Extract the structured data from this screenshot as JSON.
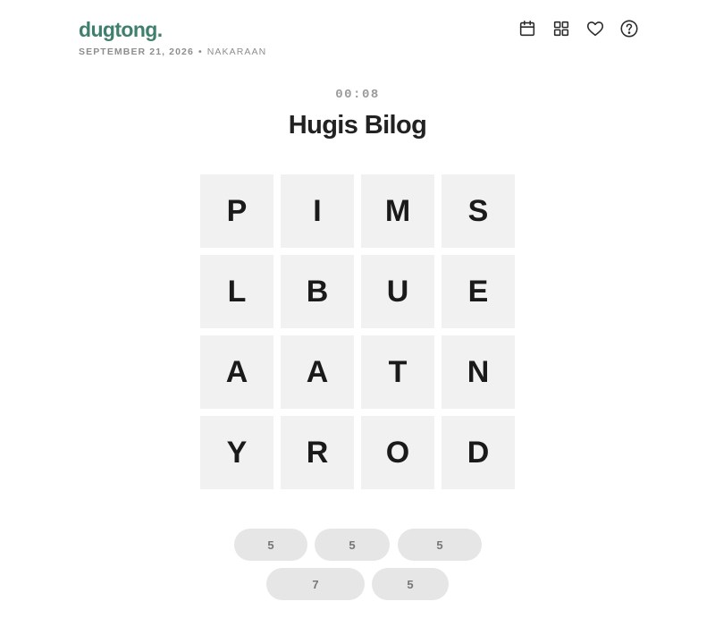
{
  "header": {
    "logo": "dugtong.",
    "date": "SEPTEMBER 21, 2026",
    "separator": "•",
    "status": "NAKARAAN",
    "icons": [
      "calendar-icon",
      "grid-icon",
      "heart-icon",
      "help-icon"
    ]
  },
  "game": {
    "timer": "00:08",
    "title": "Hugis Bilog",
    "grid": [
      [
        "P",
        "I",
        "M",
        "S"
      ],
      [
        "L",
        "B",
        "U",
        "E"
      ],
      [
        "A",
        "A",
        "T",
        "N"
      ],
      [
        "Y",
        "R",
        "O",
        "D"
      ]
    ],
    "word_lengths": [
      "5",
      "5",
      "5",
      "7",
      "5"
    ]
  },
  "colors": {
    "brand": "#3f7f6e",
    "tile_bg": "#f1f1f1",
    "pill_bg": "#e6e6e6"
  }
}
